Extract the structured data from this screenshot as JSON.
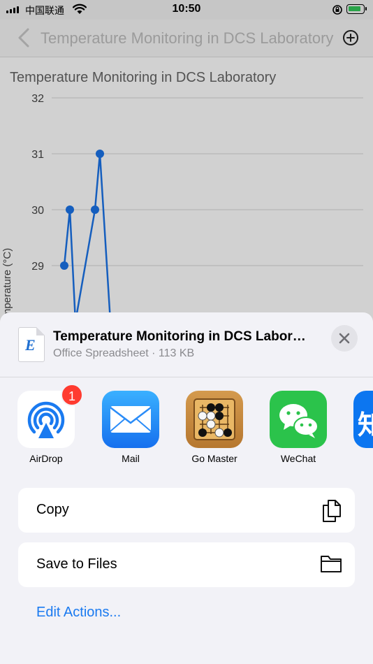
{
  "status_bar": {
    "carrier": "中国联通",
    "time": "10:50"
  },
  "navbar": {
    "title": "Temperature Monitoring in DCS Laboratory"
  },
  "chart_data": {
    "type": "line",
    "title": "Temperature Monitoring in DCS Laboratory",
    "ylabel": "Temperature (°C)",
    "y_ticks": [
      32,
      31,
      30,
      29
    ],
    "ylim": [
      28,
      32
    ],
    "series": [
      {
        "values": [
          29,
          30,
          28,
          30,
          31,
          28
        ],
        "color": "#1a73e8"
      }
    ],
    "grid": true
  },
  "share_sheet": {
    "file": {
      "icon_letter": "E",
      "name": "Temperature Monitoring in DCS Laboratory",
      "subtitle": "Office Spreadsheet · 113 KB"
    },
    "apps": [
      {
        "label": "AirDrop",
        "icon": "airdrop-icon",
        "badge": "1"
      },
      {
        "label": "Mail",
        "icon": "mail-icon"
      },
      {
        "label": "Go Master",
        "icon": "go-board-icon"
      },
      {
        "label": "WeChat",
        "icon": "wechat-icon"
      },
      {
        "icon_text": "知",
        "icon": "zhihu-icon"
      }
    ],
    "actions": [
      {
        "label": "Copy",
        "icon": "copy-icon"
      },
      {
        "label": "Save to Files",
        "icon": "folder-icon"
      }
    ],
    "edit_actions": "Edit Actions..."
  },
  "colors": {
    "accent": "#1a7af0",
    "badge": "#ff3b30",
    "series": "#1a73e8"
  }
}
